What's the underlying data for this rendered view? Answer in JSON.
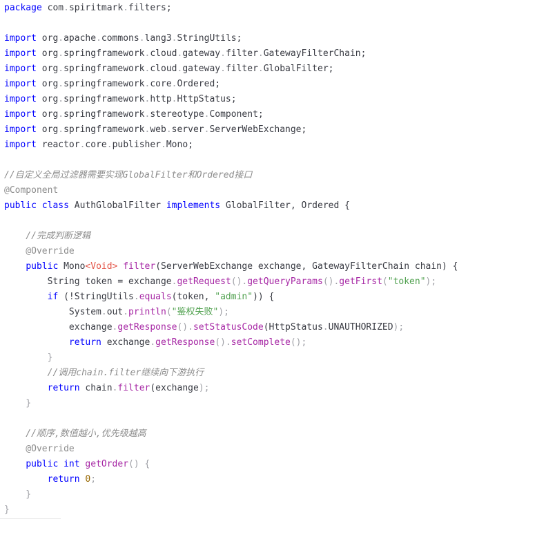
{
  "code": {
    "language": "java",
    "lines": [
      [
        {
          "t": "package",
          "c": "kw"
        },
        {
          "t": " com",
          "c": "pkg"
        },
        {
          "t": ".",
          "c": "dot"
        },
        {
          "t": "spiritmark",
          "c": "pkg"
        },
        {
          "t": ".",
          "c": "dot"
        },
        {
          "t": "filters",
          "c": "pkg"
        },
        {
          "t": ";",
          "c": "punc"
        }
      ],
      [],
      [
        {
          "t": "import",
          "c": "kw"
        },
        {
          "t": " org",
          "c": "pkg"
        },
        {
          "t": ".",
          "c": "dot"
        },
        {
          "t": "apache",
          "c": "pkg"
        },
        {
          "t": ".",
          "c": "dot"
        },
        {
          "t": "commons",
          "c": "pkg"
        },
        {
          "t": ".",
          "c": "dot"
        },
        {
          "t": "lang3",
          "c": "pkg"
        },
        {
          "t": ".",
          "c": "dot"
        },
        {
          "t": "StringUtils",
          "c": "pkg"
        },
        {
          "t": ";",
          "c": "punc"
        }
      ],
      [
        {
          "t": "import",
          "c": "kw"
        },
        {
          "t": " org",
          "c": "pkg"
        },
        {
          "t": ".",
          "c": "dot"
        },
        {
          "t": "springframework",
          "c": "pkg"
        },
        {
          "t": ".",
          "c": "dot"
        },
        {
          "t": "cloud",
          "c": "pkg"
        },
        {
          "t": ".",
          "c": "dot"
        },
        {
          "t": "gateway",
          "c": "pkg"
        },
        {
          "t": ".",
          "c": "dot"
        },
        {
          "t": "filter",
          "c": "pkg"
        },
        {
          "t": ".",
          "c": "dot"
        },
        {
          "t": "GatewayFilterChain",
          "c": "pkg"
        },
        {
          "t": ";",
          "c": "punc"
        }
      ],
      [
        {
          "t": "import",
          "c": "kw"
        },
        {
          "t": " org",
          "c": "pkg"
        },
        {
          "t": ".",
          "c": "dot"
        },
        {
          "t": "springframework",
          "c": "pkg"
        },
        {
          "t": ".",
          "c": "dot"
        },
        {
          "t": "cloud",
          "c": "pkg"
        },
        {
          "t": ".",
          "c": "dot"
        },
        {
          "t": "gateway",
          "c": "pkg"
        },
        {
          "t": ".",
          "c": "dot"
        },
        {
          "t": "filter",
          "c": "pkg"
        },
        {
          "t": ".",
          "c": "dot"
        },
        {
          "t": "GlobalFilter",
          "c": "pkg"
        },
        {
          "t": ";",
          "c": "punc"
        }
      ],
      [
        {
          "t": "import",
          "c": "kw"
        },
        {
          "t": " org",
          "c": "pkg"
        },
        {
          "t": ".",
          "c": "dot"
        },
        {
          "t": "springframework",
          "c": "pkg"
        },
        {
          "t": ".",
          "c": "dot"
        },
        {
          "t": "core",
          "c": "pkg"
        },
        {
          "t": ".",
          "c": "dot"
        },
        {
          "t": "Ordered",
          "c": "pkg"
        },
        {
          "t": ";",
          "c": "punc"
        }
      ],
      [
        {
          "t": "import",
          "c": "kw"
        },
        {
          "t": " org",
          "c": "pkg"
        },
        {
          "t": ".",
          "c": "dot"
        },
        {
          "t": "springframework",
          "c": "pkg"
        },
        {
          "t": ".",
          "c": "dot"
        },
        {
          "t": "http",
          "c": "pkg"
        },
        {
          "t": ".",
          "c": "dot"
        },
        {
          "t": "HttpStatus",
          "c": "pkg"
        },
        {
          "t": ";",
          "c": "punc"
        }
      ],
      [
        {
          "t": "import",
          "c": "kw"
        },
        {
          "t": " org",
          "c": "pkg"
        },
        {
          "t": ".",
          "c": "dot"
        },
        {
          "t": "springframework",
          "c": "pkg"
        },
        {
          "t": ".",
          "c": "dot"
        },
        {
          "t": "stereotype",
          "c": "pkg"
        },
        {
          "t": ".",
          "c": "dot"
        },
        {
          "t": "Component",
          "c": "pkg"
        },
        {
          "t": ";",
          "c": "punc"
        }
      ],
      [
        {
          "t": "import",
          "c": "kw"
        },
        {
          "t": " org",
          "c": "pkg"
        },
        {
          "t": ".",
          "c": "dot"
        },
        {
          "t": "springframework",
          "c": "pkg"
        },
        {
          "t": ".",
          "c": "dot"
        },
        {
          "t": "web",
          "c": "pkg"
        },
        {
          "t": ".",
          "c": "dot"
        },
        {
          "t": "server",
          "c": "pkg"
        },
        {
          "t": ".",
          "c": "dot"
        },
        {
          "t": "ServerWebExchange",
          "c": "pkg"
        },
        {
          "t": ";",
          "c": "punc"
        }
      ],
      [
        {
          "t": "import",
          "c": "kw"
        },
        {
          "t": " reactor",
          "c": "pkg"
        },
        {
          "t": ".",
          "c": "dot"
        },
        {
          "t": "core",
          "c": "pkg"
        },
        {
          "t": ".",
          "c": "dot"
        },
        {
          "t": "publisher",
          "c": "pkg"
        },
        {
          "t": ".",
          "c": "dot"
        },
        {
          "t": "Mono",
          "c": "pkg"
        },
        {
          "t": ";",
          "c": "punc"
        }
      ],
      [],
      [
        {
          "t": "//自定义全局过滤器需要实现GlobalFilter和Ordered接口",
          "c": "cm"
        }
      ],
      [
        {
          "t": "@Component",
          "c": "ann"
        }
      ],
      [
        {
          "t": "public",
          "c": "kw"
        },
        {
          "t": " ",
          "c": "punc"
        },
        {
          "t": "class",
          "c": "kw"
        },
        {
          "t": " AuthGlobalFilter ",
          "c": "type"
        },
        {
          "t": "implements",
          "c": "kw"
        },
        {
          "t": " GlobalFilter, Ordered {",
          "c": "type"
        }
      ],
      [],
      [
        {
          "t": "    //完成判断逻辑",
          "c": "cm"
        }
      ],
      [
        {
          "t": "    @Override",
          "c": "ann"
        }
      ],
      [
        {
          "t": "    ",
          "c": "punc"
        },
        {
          "t": "public",
          "c": "kw"
        },
        {
          "t": " Mono",
          "c": "type"
        },
        {
          "t": "<Void>",
          "c": "gen"
        },
        {
          "t": " ",
          "c": "punc"
        },
        {
          "t": "filter",
          "c": "call"
        },
        {
          "t": "(ServerWebExchange exchange, GatewayFilterChain chain) {",
          "c": "type"
        }
      ],
      [
        {
          "t": "        String token = exchange",
          "c": "type"
        },
        {
          "t": ".",
          "c": "dot"
        },
        {
          "t": "getRequest",
          "c": "call"
        },
        {
          "t": "()",
          "c": "dot"
        },
        {
          "t": ".",
          "c": "dot"
        },
        {
          "t": "getQueryParams",
          "c": "call"
        },
        {
          "t": "()",
          "c": "dot"
        },
        {
          "t": ".",
          "c": "dot"
        },
        {
          "t": "getFirst",
          "c": "call"
        },
        {
          "t": "(",
          "c": "dot"
        },
        {
          "t": "\"token\"",
          "c": "str"
        },
        {
          "t": ");",
          "c": "dot"
        }
      ],
      [
        {
          "t": "        ",
          "c": "punc"
        },
        {
          "t": "if",
          "c": "kw"
        },
        {
          "t": " (!StringUtils",
          "c": "type"
        },
        {
          "t": ".",
          "c": "dot"
        },
        {
          "t": "equals",
          "c": "call"
        },
        {
          "t": "(token, ",
          "c": "type"
        },
        {
          "t": "\"admin\"",
          "c": "str"
        },
        {
          "t": ")) {",
          "c": "type"
        }
      ],
      [
        {
          "t": "            System",
          "c": "type"
        },
        {
          "t": ".",
          "c": "dot"
        },
        {
          "t": "out",
          "c": "type"
        },
        {
          "t": ".",
          "c": "dot"
        },
        {
          "t": "println",
          "c": "call"
        },
        {
          "t": "(",
          "c": "dot"
        },
        {
          "t": "\"鉴权失败\"",
          "c": "str"
        },
        {
          "t": ");",
          "c": "dot"
        }
      ],
      [
        {
          "t": "            exchange",
          "c": "type"
        },
        {
          "t": ".",
          "c": "dot"
        },
        {
          "t": "getResponse",
          "c": "call"
        },
        {
          "t": "()",
          "c": "dot"
        },
        {
          "t": ".",
          "c": "dot"
        },
        {
          "t": "setStatusCode",
          "c": "call"
        },
        {
          "t": "(HttpStatus",
          "c": "type"
        },
        {
          "t": ".",
          "c": "dot"
        },
        {
          "t": "UNAUTHORIZED",
          "c": "type"
        },
        {
          "t": ");",
          "c": "dot"
        }
      ],
      [
        {
          "t": "            ",
          "c": "punc"
        },
        {
          "t": "return",
          "c": "kw"
        },
        {
          "t": " exchange",
          "c": "type"
        },
        {
          "t": ".",
          "c": "dot"
        },
        {
          "t": "getResponse",
          "c": "call"
        },
        {
          "t": "()",
          "c": "dot"
        },
        {
          "t": ".",
          "c": "dot"
        },
        {
          "t": "setComplete",
          "c": "call"
        },
        {
          "t": "();",
          "c": "dot"
        }
      ],
      [
        {
          "t": "        }",
          "c": "dot"
        }
      ],
      [
        {
          "t": "        //调用chain.filter继续向下游执行",
          "c": "cm"
        }
      ],
      [
        {
          "t": "        ",
          "c": "punc"
        },
        {
          "t": "return",
          "c": "kw"
        },
        {
          "t": " chain",
          "c": "type"
        },
        {
          "t": ".",
          "c": "dot"
        },
        {
          "t": "filter",
          "c": "call"
        },
        {
          "t": "(exchange",
          "c": "type"
        },
        {
          "t": ");",
          "c": "dot"
        }
      ],
      [
        {
          "t": "    }",
          "c": "dot"
        }
      ],
      [],
      [
        {
          "t": "    //顺序,数值越小,优先级越高",
          "c": "cm"
        }
      ],
      [
        {
          "t": "    @Override",
          "c": "ann"
        }
      ],
      [
        {
          "t": "    ",
          "c": "punc"
        },
        {
          "t": "public",
          "c": "kw"
        },
        {
          "t": " ",
          "c": "punc"
        },
        {
          "t": "int",
          "c": "kw"
        },
        {
          "t": " ",
          "c": "punc"
        },
        {
          "t": "getOrder",
          "c": "call"
        },
        {
          "t": "() {",
          "c": "dot"
        }
      ],
      [
        {
          "t": "        ",
          "c": "punc"
        },
        {
          "t": "return",
          "c": "kw"
        },
        {
          "t": " ",
          "c": "punc"
        },
        {
          "t": "0",
          "c": "num"
        },
        {
          "t": ";",
          "c": "dot"
        }
      ],
      [
        {
          "t": "    }",
          "c": "dot"
        }
      ],
      [
        {
          "t": "}",
          "c": "dot"
        }
      ]
    ]
  }
}
